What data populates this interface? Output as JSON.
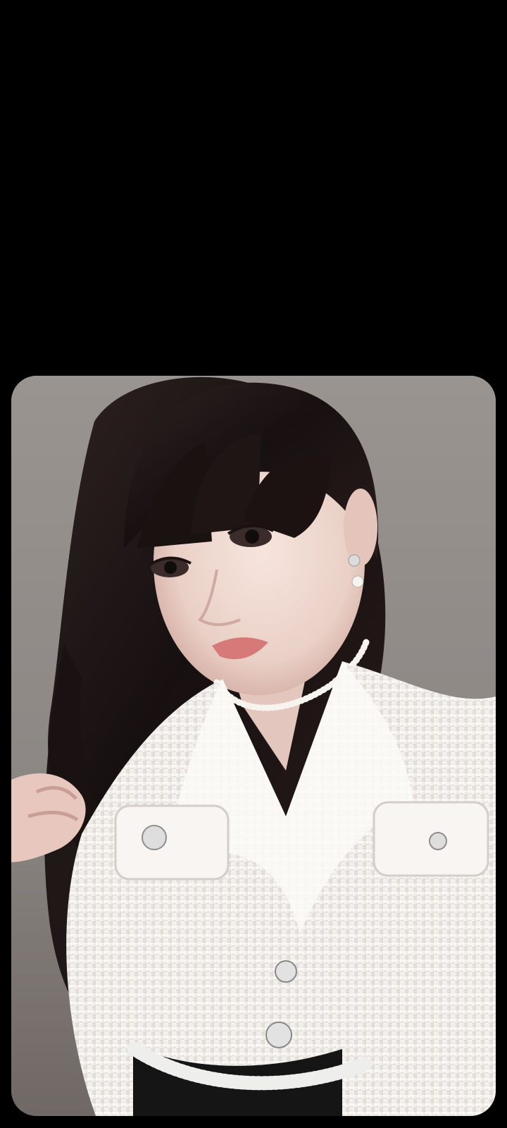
{
  "screen": {
    "background_color": "#000000"
  },
  "photo": {
    "wall_color": "#8f8a86",
    "hair_color": "#1e1514",
    "skin_color": "#eed8cf",
    "jacket_color": "#f3f1ee",
    "pearl_color": "#f7f4ef",
    "lip_color": "#d67978"
  }
}
